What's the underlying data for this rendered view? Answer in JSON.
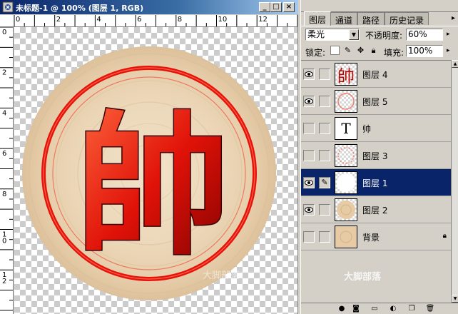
{
  "window": {
    "title": "未标题-1 @ 100% (图层 1, RGB)",
    "minimize": "_",
    "maximize": "□",
    "close": "×"
  },
  "ruler": {
    "h_marks": [
      "0",
      "2",
      "4",
      "6",
      "8",
      "10",
      "12"
    ],
    "v_marks": [
      "0",
      "2",
      "4",
      "6",
      "8",
      "1\n0",
      "1\n2"
    ]
  },
  "canvas": {
    "character": "帥",
    "watermark": "大脚部落"
  },
  "panel": {
    "tabs": [
      "图层",
      "通道",
      "路径",
      "历史记录"
    ],
    "menu_arrow": "▸",
    "blend_mode": "柔光",
    "opacity_label": "不透明度:",
    "opacity_value": "60%",
    "lock_label": "锁定:",
    "fill_label": "填充:",
    "fill_value": "100%",
    "watermark": "大脚部落"
  },
  "layers": [
    {
      "name": "图层 4",
      "visible": true,
      "thumb": "text-red",
      "thumb_text": "帥"
    },
    {
      "name": "图层 5",
      "visible": true,
      "thumb": "ring"
    },
    {
      "name": "帅",
      "visible": false,
      "thumb": "type",
      "thumb_text": "T"
    },
    {
      "name": "图层 3",
      "visible": false,
      "thumb": "ring-dots"
    },
    {
      "name": "图层 1",
      "visible": true,
      "thumb": "white",
      "selected": true
    },
    {
      "name": "图层 2",
      "visible": true,
      "thumb": "disk"
    },
    {
      "name": "背景",
      "visible": false,
      "thumb": "solid",
      "locked": true
    }
  ],
  "colors": {
    "titlebar": "#0a246a",
    "selection": "#0a246a",
    "ring_red": "#e8120c",
    "wood": "#ead4b4"
  }
}
